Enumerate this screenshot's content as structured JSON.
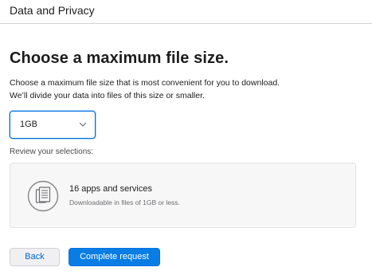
{
  "header": {
    "title": "Data and Privacy"
  },
  "main": {
    "heading": "Choose a maximum file size.",
    "description_lines": [
      "Choose a maximum file size that is most convenient for you to download.",
      "We’ll divide your data into files of this size or smaller."
    ],
    "file_size_select": {
      "selected": "1GB"
    },
    "review_label": "Review your selections:",
    "summary": {
      "title": "16 apps and services",
      "subtitle": "Downloadable in files of 1GB or less.",
      "icon": "documents-icon"
    }
  },
  "actions": {
    "back_label": "Back",
    "complete_label": "Complete request"
  },
  "colors": {
    "accent": "#0071e3",
    "button_primary": "#0a7de5",
    "link": "#0066cc",
    "border": "#d2d2d7"
  }
}
